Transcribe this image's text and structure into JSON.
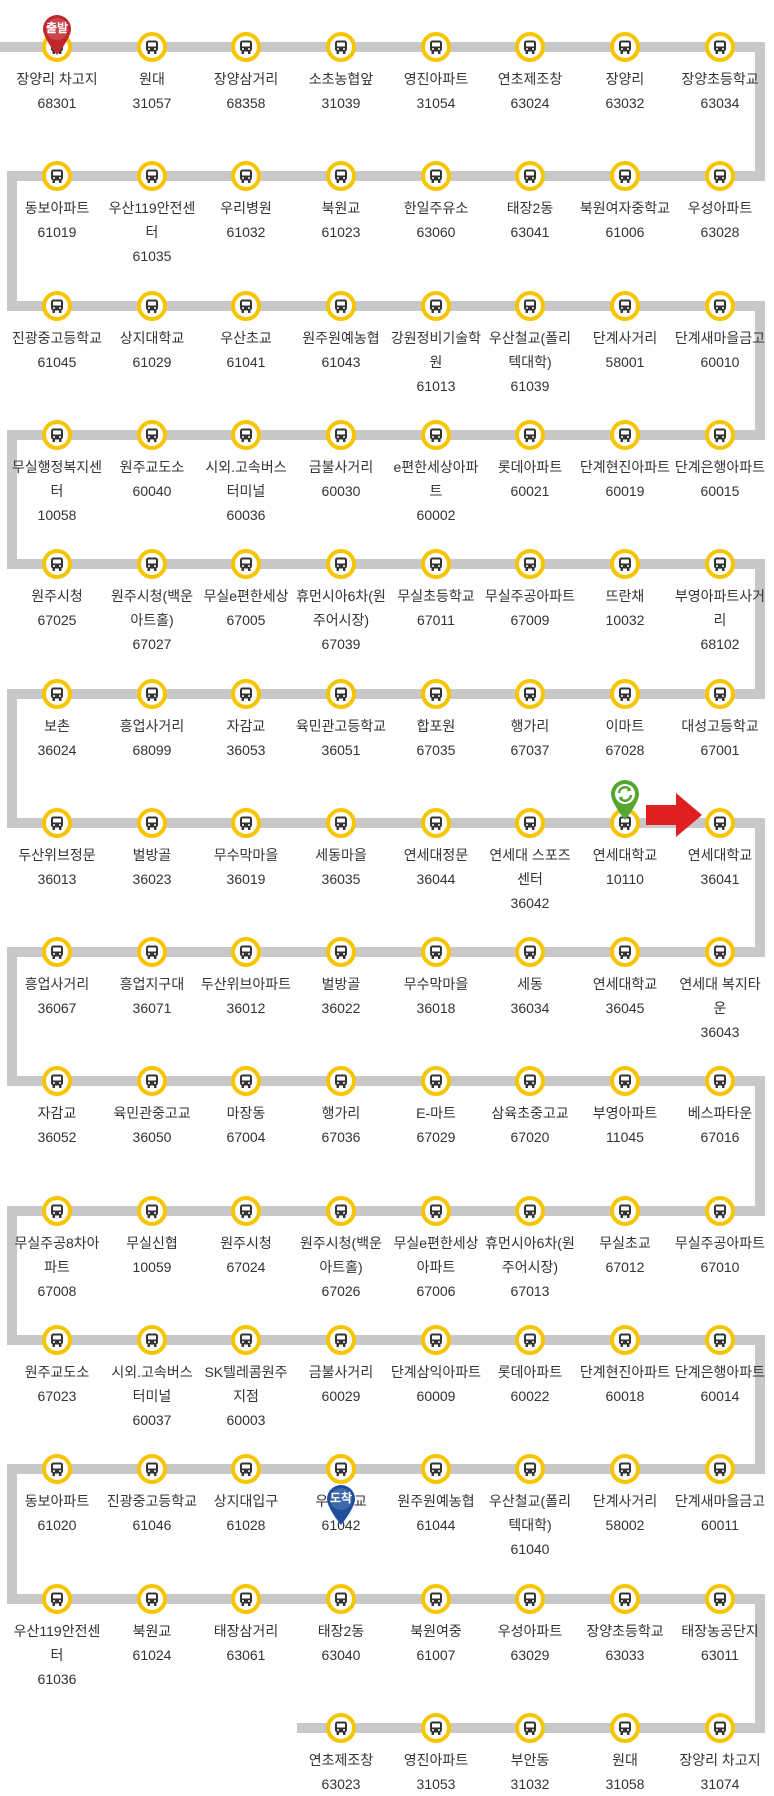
{
  "colors": {
    "track": "#c8c8c8",
    "stop_ring": "#f7c400",
    "bus": "#333333",
    "start_pin": "#c0272d",
    "end_pin": "#1d4f9c",
    "turn_icon": "#55a630",
    "current_arrow": "#e02020"
  },
  "icons": {
    "stop": "bus-icon",
    "start": "start-pin-icon",
    "end": "end-pin-icon",
    "turnaround": "turnaround-icon",
    "current": "current-position-arrow-icon"
  },
  "markers": {
    "start_label": "출발",
    "end_label": "도착"
  },
  "stops": [
    {
      "name": "장양리 차고지",
      "id": "68301"
    },
    {
      "name": "원대",
      "id": "31057"
    },
    {
      "name": "장양삼거리",
      "id": "68358"
    },
    {
      "name": "소초농협앞",
      "id": "31039"
    },
    {
      "name": "영진아파트",
      "id": "31054"
    },
    {
      "name": "연초제조창",
      "id": "63024"
    },
    {
      "name": "장양리",
      "id": "63032"
    },
    {
      "name": "장양초등학교",
      "id": "63034"
    },
    {
      "name": "우성아파트",
      "id": "63028"
    },
    {
      "name": "북원여자중학교",
      "id": "61006"
    },
    {
      "name": "태장2동",
      "id": "63041"
    },
    {
      "name": "한일주유소",
      "id": "63060"
    },
    {
      "name": "북원교",
      "id": "61023"
    },
    {
      "name": "우리병원",
      "id": "61032"
    },
    {
      "name": "우산119안전센터",
      "id": "61035"
    },
    {
      "name": "동보아파트",
      "id": "61019"
    },
    {
      "name": "진광중고등학교",
      "id": "61045"
    },
    {
      "name": "상지대학교",
      "id": "61029"
    },
    {
      "name": "우산초교",
      "id": "61041"
    },
    {
      "name": "원주원예농협",
      "id": "61043"
    },
    {
      "name": "강원정비기술학원",
      "id": "61013"
    },
    {
      "name": "우산철교(폴리텍대학)",
      "id": "61039"
    },
    {
      "name": "단계사거리",
      "id": "58001"
    },
    {
      "name": "단계새마을금고",
      "id": "60010"
    },
    {
      "name": "단계은행아파트",
      "id": "60015"
    },
    {
      "name": "단계현진아파트",
      "id": "60019"
    },
    {
      "name": "롯데아파트",
      "id": "60021"
    },
    {
      "name": "e편한세상아파트",
      "id": "60002"
    },
    {
      "name": "금불사거리",
      "id": "60030"
    },
    {
      "name": "시외.고속버스터미널",
      "id": "60036"
    },
    {
      "name": "원주교도소",
      "id": "60040"
    },
    {
      "name": "무실행정복지센터",
      "id": "10058"
    },
    {
      "name": "원주시청",
      "id": "67025"
    },
    {
      "name": "원주시청(백운아트홀)",
      "id": "67027"
    },
    {
      "name": "무실e편한세상",
      "id": "67005"
    },
    {
      "name": "휴먼시아6차(원주어시장)",
      "id": "67039"
    },
    {
      "name": "무실초등학교",
      "id": "67011"
    },
    {
      "name": "무실주공아파트",
      "id": "67009"
    },
    {
      "name": "뜨란채",
      "id": "10032"
    },
    {
      "name": "부영아파트사거리",
      "id": "68102"
    },
    {
      "name": "대성고등학교",
      "id": "67001"
    },
    {
      "name": "이마트",
      "id": "67028"
    },
    {
      "name": "행가리",
      "id": "67037"
    },
    {
      "name": "합포원",
      "id": "67035"
    },
    {
      "name": "육민관고등학교",
      "id": "36051"
    },
    {
      "name": "자감교",
      "id": "36053"
    },
    {
      "name": "흥업사거리",
      "id": "68099"
    },
    {
      "name": "보촌",
      "id": "36024"
    },
    {
      "name": "두산위브정문",
      "id": "36013"
    },
    {
      "name": "벌방골",
      "id": "36023"
    },
    {
      "name": "무수막마을",
      "id": "36019"
    },
    {
      "name": "세동마을",
      "id": "36035"
    },
    {
      "name": "연세대정문",
      "id": "36044"
    },
    {
      "name": "연세대 스포즈센터",
      "id": "36042"
    },
    {
      "name": "연세대학교",
      "id": "10110"
    },
    {
      "name": "연세대학교",
      "id": "36041"
    },
    {
      "name": "연세대 복지타운",
      "id": "36043"
    },
    {
      "name": "연세대학교",
      "id": "36045"
    },
    {
      "name": "세동",
      "id": "36034"
    },
    {
      "name": "무수막마을",
      "id": "36018"
    },
    {
      "name": "벌방골",
      "id": "36022"
    },
    {
      "name": "두산위브아파트",
      "id": "36012"
    },
    {
      "name": "흥업지구대",
      "id": "36071"
    },
    {
      "name": "흥업사거리",
      "id": "36067"
    },
    {
      "name": "자감교",
      "id": "36052"
    },
    {
      "name": "육민관중고교",
      "id": "36050"
    },
    {
      "name": "마장동",
      "id": "67004"
    },
    {
      "name": "행가리",
      "id": "67036"
    },
    {
      "name": "E-마트",
      "id": "67029"
    },
    {
      "name": "삼육초중고교",
      "id": "67020"
    },
    {
      "name": "부영아파트",
      "id": "11045"
    },
    {
      "name": "베스파타운",
      "id": "67016"
    },
    {
      "name": "무실주공아파트",
      "id": "67010"
    },
    {
      "name": "무실초교",
      "id": "67012"
    },
    {
      "name": "휴먼시아6차(원주어시장)",
      "id": "67013"
    },
    {
      "name": "무실e편한세상아파트",
      "id": "67006"
    },
    {
      "name": "원주시청(백운아트홀)",
      "id": "67026"
    },
    {
      "name": "원주시청",
      "id": "67024"
    },
    {
      "name": "무실신협",
      "id": "10059"
    },
    {
      "name": "무실주공8차아파트",
      "id": "67008"
    },
    {
      "name": "원주교도소",
      "id": "67023"
    },
    {
      "name": "시외.고속버스터미널",
      "id": "60037"
    },
    {
      "name": "SK텔레콤원주지점",
      "id": "60003"
    },
    {
      "name": "금불사거리",
      "id": "60029"
    },
    {
      "name": "단계삼익아파트",
      "id": "60009"
    },
    {
      "name": "롯데아파트",
      "id": "60022"
    },
    {
      "name": "단계현진아파트",
      "id": "60018"
    },
    {
      "name": "단계은행아파트",
      "id": "60014"
    },
    {
      "name": "단계새마을금고",
      "id": "60011"
    },
    {
      "name": "단계사거리",
      "id": "58002"
    },
    {
      "name": "우산철교(폴리텍대학)",
      "id": "61040"
    },
    {
      "name": "원주원예농협",
      "id": "61044"
    },
    {
      "name": "우산초교",
      "id": "61042"
    },
    {
      "name": "상지대입구",
      "id": "61028"
    },
    {
      "name": "진광중고등학교",
      "id": "61046"
    },
    {
      "name": "동보아파트",
      "id": "61020"
    },
    {
      "name": "우산119안전센터",
      "id": "61036"
    },
    {
      "name": "북원교",
      "id": "61024"
    },
    {
      "name": "태장삼거리",
      "id": "63061"
    },
    {
      "name": "태장2동",
      "id": "63040"
    },
    {
      "name": "북원여중",
      "id": "61007"
    },
    {
      "name": "우성아파트",
      "id": "63029"
    },
    {
      "name": "장양초등학교",
      "id": "63033"
    },
    {
      "name": "태장농공단지",
      "id": "63011"
    },
    {
      "name": "연초제조창",
      "id": "63023"
    },
    {
      "name": "영진아파트",
      "id": "31053"
    },
    {
      "name": "부안동",
      "id": "31032"
    },
    {
      "name": "원대",
      "id": "31058"
    },
    {
      "name": "장양리 차고지",
      "id": "31074"
    }
  ]
}
